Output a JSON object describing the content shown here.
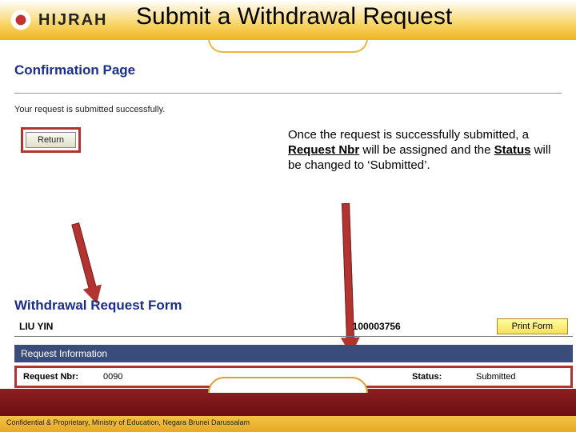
{
  "header": {
    "logo_text": "HIJRAH"
  },
  "title": "Submit a Withdrawal Request",
  "confirmation": {
    "heading": "Confirmation Page",
    "message": "Your request is submitted successfully.",
    "return_label": "Return"
  },
  "explanation": {
    "p1": "Once the request is successfully submitted, a ",
    "b1": "Request Nbr",
    "p2": " will be assigned and the ",
    "b2": "Status",
    "p3": " will be changed to ‘Submitted’."
  },
  "form": {
    "heading": "Withdrawal Request Form",
    "student_name": "LIU YIN",
    "student_id": "100003756",
    "print_label": "Print Form",
    "section_bar": "Request Information",
    "req_label": "Request Nbr:",
    "req_value": "0090",
    "status_label": "Status:",
    "status_value": "Submitted"
  },
  "footer": {
    "text": "Confidential & Proprietary, Ministry of Education, Negara Brunei Darussalam"
  }
}
